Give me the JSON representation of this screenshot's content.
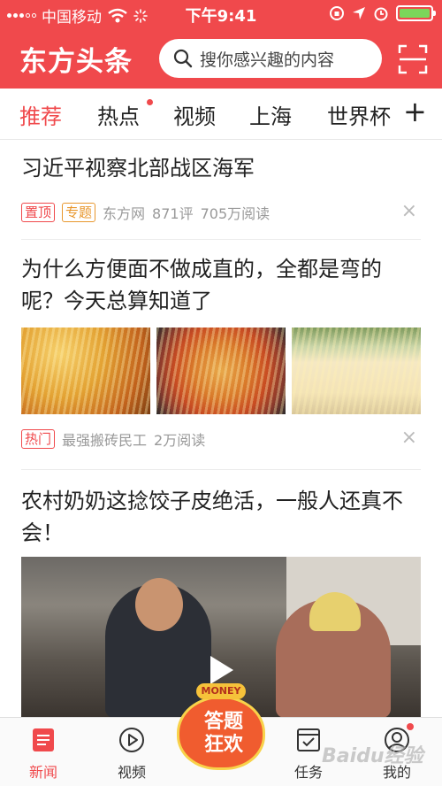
{
  "status_bar": {
    "carrier": "中国移动",
    "time": "下午9:41",
    "battery_level": 1.0
  },
  "header": {
    "logo": "东方头条",
    "search_placeholder": "搜你感兴趣的内容",
    "brand_color": "#f0494c"
  },
  "tabs": [
    {
      "label": "推荐",
      "active": true
    },
    {
      "label": "热点",
      "has_dot": true
    },
    {
      "label": "视频"
    },
    {
      "label": "上海"
    },
    {
      "label": "世界杯"
    }
  ],
  "tab_add": "+",
  "feed": [
    {
      "title": "习近平视察北部战区海军",
      "tags": [
        "置顶",
        "专题"
      ],
      "source": "东方网",
      "comments": "871评",
      "reads": "705万阅读"
    },
    {
      "title": "为什么方便面不做成直的，全都是弯的呢？今天总算知道了",
      "tags": [
        "热门"
      ],
      "source": "最强搬砖民工",
      "reads": "2万阅读",
      "images": [
        "noodles-fork-photo",
        "noodle-soup-bowl-photo",
        "dry-noodle-plate-photo"
      ]
    },
    {
      "title": "农村奶奶这捻饺子皮绝活，一般人还真不会！",
      "video": "rural-dumpling-video"
    }
  ],
  "close_symbol": "×",
  "bottom_nav": [
    {
      "label": "新闻",
      "icon": "news-icon",
      "active": true
    },
    {
      "label": "视频",
      "icon": "video-play-icon"
    },
    {
      "label": "任务",
      "icon": "task-icon"
    },
    {
      "label": "我的",
      "icon": "profile-icon"
    }
  ],
  "promo": {
    "top": "MONEY",
    "line1": "答题",
    "line2": "狂欢"
  },
  "watermark": "Baidu经验"
}
